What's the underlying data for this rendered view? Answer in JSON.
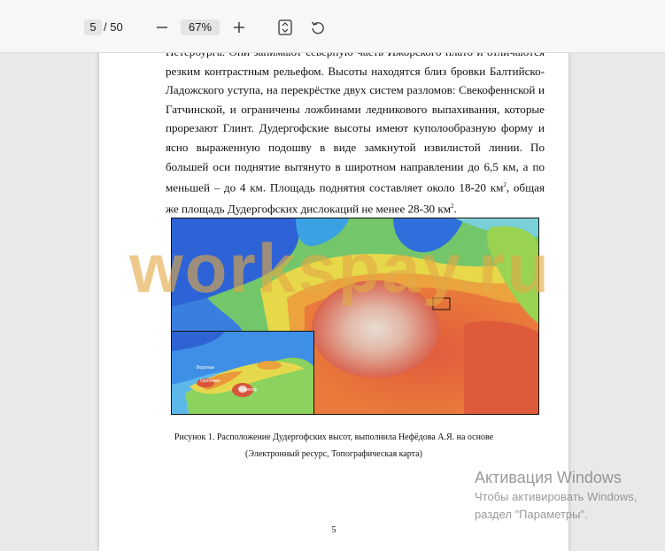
{
  "toolbar": {
    "current_page": "5",
    "total_pages": "/ 50",
    "zoom": "67%",
    "icons": [
      "minus-icon",
      "plus-icon",
      "fit-page-icon",
      "rotate-icon"
    ]
  },
  "document": {
    "paragraph": [
      "Петербурга. Они занимают северную часть Ижорского плато и отличаются резким контрастным рельефом. Высоты находятся близ бровки Балтийско-Ладожского уступа, на перекрёстке двух систем разломов: Свекофеннской и Гатчинской, и ограничены ложбинами ледникового выпахивания, которые прорезают Глинт. Дудергофские высоты имеют куполообразную форму и ясно выраженную подошву в виде замкнутой извилистой линии. По большей оси поднятие вытянуто в широтном направлении до 6,5 км, а по меньшей – до 4 км. Площадь поднятия составляет около 18-20 км",
      "2",
      ", общая же площадь Дудергофских дислокаций не менее 28-30 км",
      "2",
      "."
    ],
    "inset_labels": [
      "Вороньи",
      "Ореховая",
      "Кирхгоф"
    ],
    "caption_line1": "Рисунок 1. Расположение Дудергофских высот, выполнила Нефёдова А.Я. на основе",
    "caption_line2": "(Электронный ресурс, Топографическая карта)",
    "page_number": "5"
  },
  "watermark": "workspay.ru",
  "activation": {
    "title": "Активация Windows",
    "line1": "Чтобы активировать Windows,",
    "line2": "раздел \"Параметры\"."
  },
  "colors": {
    "toolbar_bg": "#f7f7f7",
    "page_bg": "#ffffff",
    "watermark": "#e2aa46"
  }
}
